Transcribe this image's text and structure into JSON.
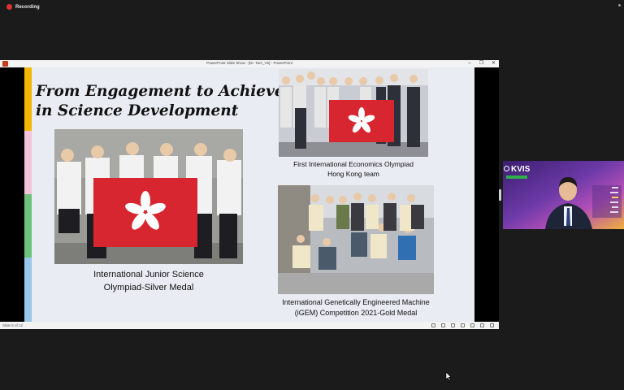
{
  "recording": {
    "label": "Recording"
  },
  "window": {
    "title": "PowerPoint Slide Show - [Dr. Tam_V5] - PowerPoint"
  },
  "slide": {
    "title_line1": "From Engagement to Achievement",
    "title_line2": "in Science Development",
    "captions": {
      "ijso_line1": "International Junior Science",
      "ijso_line2": "Olympiad-Silver Medal",
      "ieo_line1": "First International Economics Olympiad",
      "ieo_line2": "Hong Kong team",
      "igem_line1": "International Genetically Engineered Machine",
      "igem_line2": "(iGEM) Competition 2021-Gold Medal"
    },
    "accent_colors": [
      "#f2b705",
      "#f3c3d9",
      "#6cc27a",
      "#9ac6ea"
    ],
    "flag_color": "#d7262f"
  },
  "status": {
    "slide_counter": "Slide 5 of 12"
  },
  "video": {
    "brand": "KVIS"
  }
}
